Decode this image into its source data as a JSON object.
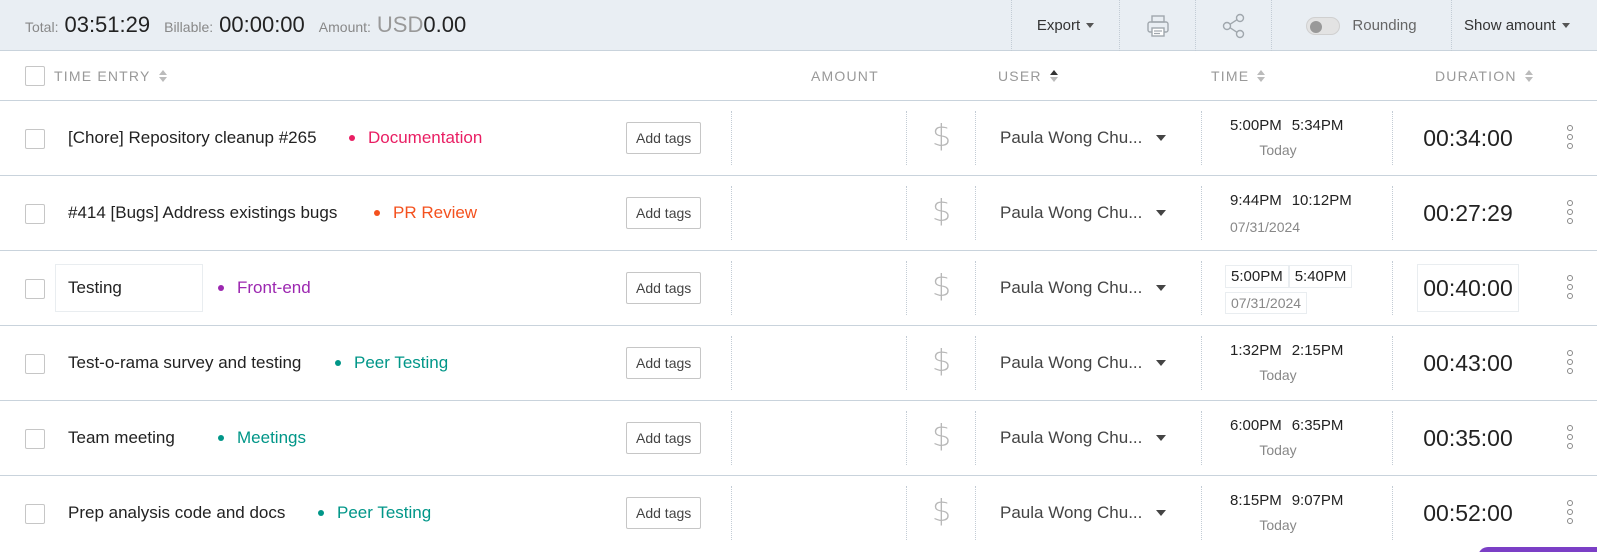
{
  "summary": {
    "total_label": "Total:",
    "total_value": "03:51:29",
    "billable_label": "Billable:",
    "billable_value": "00:00:00",
    "amount_label": "Amount:",
    "amount_currency": "USD",
    "amount_value": "0.00",
    "export_label": "Export",
    "print_icon": "printer-icon",
    "share_icon": "share-icon",
    "rounding_label": "Rounding",
    "rounding_enabled": false,
    "show_amount_label": "Show amount"
  },
  "columns": {
    "time_entry": "TIME ENTRY",
    "amount": "AMOUNT",
    "user": "USER",
    "time": "TIME",
    "duration": "DURATION"
  },
  "tag_button_label": "Add tags",
  "billable_symbol": "$",
  "entries": [
    {
      "description": "[Chore] Repository cleanup #265",
      "project": "Documentation",
      "project_color": "#e91e63",
      "user": "Paula Wong Chu...",
      "start": "5:00PM",
      "end": "5:34PM",
      "date": "Today",
      "duration": "00:34:00"
    },
    {
      "description": "#414 [Bugs] Address existings bugs",
      "project": "PR Review",
      "project_color": "#f4511e",
      "user": "Paula Wong Chu...",
      "start": "9:44PM",
      "end": "10:12PM",
      "date": "07/31/2024",
      "duration": "00:27:29"
    },
    {
      "description": "Testing",
      "project": "Front-end",
      "project_color": "#9c27b0",
      "user": "Paula Wong Chu...",
      "start": "5:00PM",
      "end": "5:40PM",
      "date": "07/31/2024",
      "duration": "00:40:00"
    },
    {
      "description": "Test-o-rama survey and testing",
      "project": "Peer Testing",
      "project_color": "#009688",
      "user": "Paula Wong Chu...",
      "start": "1:32PM",
      "end": "2:15PM",
      "date": "Today",
      "duration": "00:43:00"
    },
    {
      "description": "Team meeting",
      "project": "Meetings",
      "project_color": "#009688",
      "user": "Paula Wong Chu...",
      "start": "6:00PM",
      "end": "6:35PM",
      "date": "Today",
      "duration": "00:35:00"
    },
    {
      "description": "Prep analysis code and docs",
      "project": "Peer Testing",
      "project_color": "#009688",
      "user": "Paula Wong Chu...",
      "start": "8:15PM",
      "end": "9:07PM",
      "date": "Today",
      "duration": "00:52:00"
    }
  ]
}
